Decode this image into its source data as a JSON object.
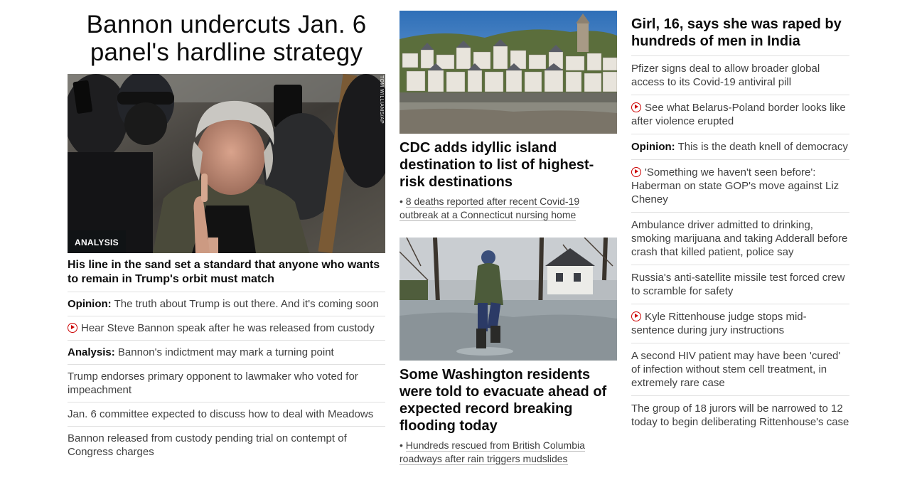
{
  "left": {
    "headline": "Bannon undercuts Jan. 6 panel's hardline strategy",
    "hero_badge": "ANALYSIS",
    "hero_credit": "TOM WILLIAMS/AP",
    "hero_sub": "His line in the sand set a standard that anyone who wants to remain in Trump's orbit must match",
    "items": [
      {
        "lead": "Opinion:",
        "text": "The truth about Trump is out there. And it's coming soon",
        "video": false
      },
      {
        "lead": "",
        "text": "Hear Steve Bannon speak after he was released from custody",
        "video": true
      },
      {
        "lead": "Analysis:",
        "text": "Bannon's indictment may mark a turning point",
        "video": false
      },
      {
        "lead": "",
        "text": "Trump endorses primary opponent to lawmaker who voted for impeachment",
        "video": false
      },
      {
        "lead": "",
        "text": "Jan. 6 committee expected to discuss how to deal with Meadows",
        "video": false
      },
      {
        "lead": "",
        "text": "Bannon released from custody pending trial on contempt of Congress charges",
        "video": false
      }
    ]
  },
  "middle": {
    "story1": {
      "headline": "CDC adds idyllic island destination to list of highest-risk destinations",
      "bullet": "8 deaths reported after recent Covid-19 outbreak at a Connecticut nursing home"
    },
    "story2": {
      "headline": "Some Washington residents were told to evacuate ahead of expected record breaking flooding today",
      "bullet": "Hundreds rescued from British Columbia roadways after rain triggers mudslides"
    }
  },
  "right": {
    "headline": "Girl, 16, says she was raped by hundreds of men in India",
    "items": [
      {
        "lead": "",
        "text": "Pfizer signs deal to allow broader global access to its Covid-19 antiviral pill",
        "video": false
      },
      {
        "lead": "",
        "text": "See what Belarus-Poland border looks like after violence erupted",
        "video": true
      },
      {
        "lead": "Opinion:",
        "text": "This is the death knell of democracy",
        "video": false
      },
      {
        "lead": "",
        "text": "'Something we haven't seen before': Haberman on state GOP's move against Liz Cheney",
        "video": true
      },
      {
        "lead": "",
        "text": "Ambulance driver admitted to drinking, smoking marijuana and taking Adderall before crash that killed patient, police say",
        "video": false
      },
      {
        "lead": "",
        "text": "Russia's anti-satellite missile test forced crew to scramble for safety",
        "video": false
      },
      {
        "lead": "",
        "text": "Kyle Rittenhouse judge stops mid-sentence during jury instructions",
        "video": true
      },
      {
        "lead": "",
        "text": "A second HIV patient may have been 'cured' of infection without stem cell treatment, in extremely rare case",
        "video": false
      },
      {
        "lead": "",
        "text": "The group of 18 jurors will be narrowed to 12 today to begin deliberating Rittenhouse's case",
        "video": false
      }
    ]
  },
  "colors": {
    "accent_red": "#cc0000",
    "text": "#262626",
    "divider": "#e0e0e0"
  },
  "icons": {
    "video": "play-circle-icon"
  }
}
